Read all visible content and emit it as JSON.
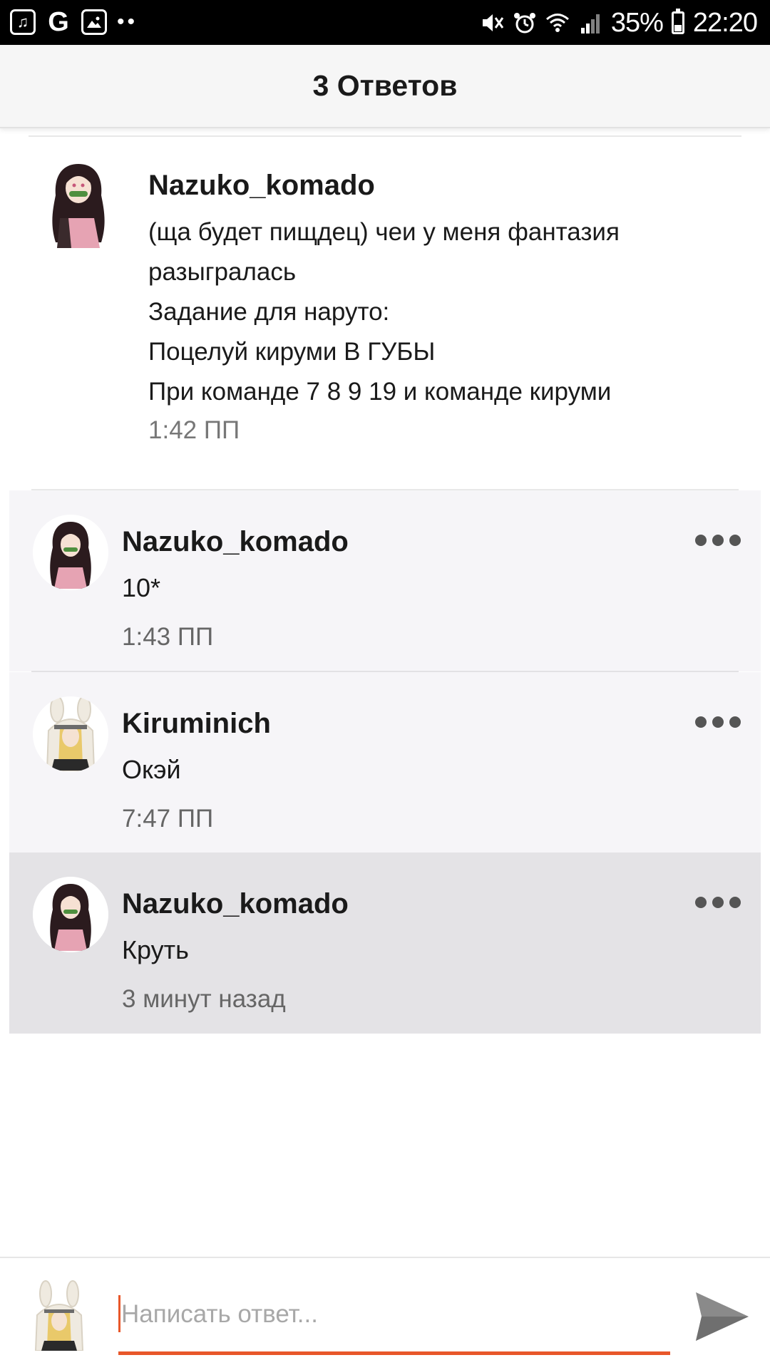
{
  "status_bar": {
    "battery": "35%",
    "battery_level": 0.35,
    "time": "22:20",
    "left_icons": [
      "music-icon",
      "google-icon",
      "image-icon",
      "more-dots-icon"
    ],
    "right_icons": [
      "mute-icon",
      "alarm-icon",
      "wifi-icon",
      "signal-icon",
      "battery-icon"
    ]
  },
  "header": {
    "title": "3 Ответов"
  },
  "post": {
    "author": "Nazuko_komado",
    "lines": [
      "(ща будет пищдец) чеи у меня фантазия",
      "разыгралась",
      "Задание для наруто:",
      "Поцелуй кируми В ГУБЫ",
      "При команде 7 8 9 19 и команде кируми"
    ],
    "time": "1:42 ПП"
  },
  "replies": [
    {
      "author": "Nazuko_komado",
      "text": "10*",
      "time": "1:43 ПП"
    },
    {
      "author": "Kiruminich",
      "text": "Окэй",
      "time": "7:47 ПП"
    },
    {
      "author": "Nazuko_komado",
      "text": "Круть",
      "time": "3 минут назад"
    }
  ],
  "composer": {
    "placeholder": "Написать ответ..."
  },
  "colors": {
    "accent": "#e8572a",
    "reply_bg": "#f6f5f8",
    "reply_active_bg": "#e4e3e6",
    "header_bg": "#f6f6f6"
  }
}
